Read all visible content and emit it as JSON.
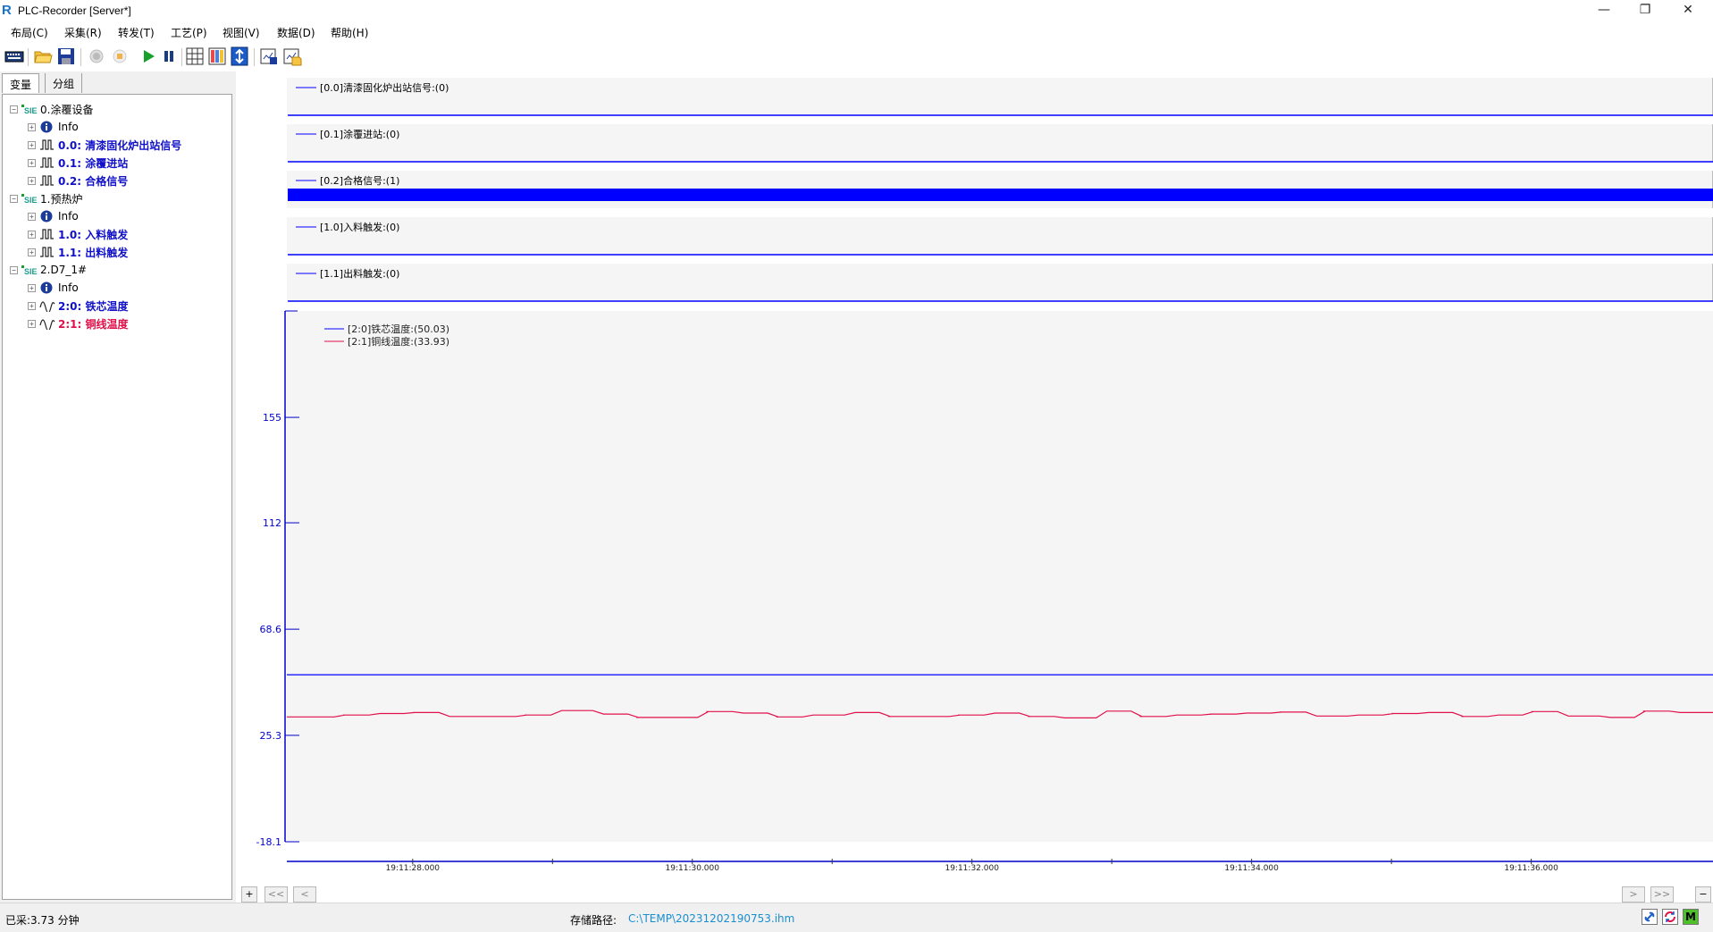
{
  "window": {
    "title": "PLC-Recorder  [Server*]",
    "controls": {
      "minimize": "—",
      "restore": "❐",
      "close": "✕"
    }
  },
  "menu": [
    "布局(C)",
    "采集(R)",
    "转发(T)",
    "工艺(P)",
    "视图(V)",
    "数据(D)",
    "帮助(H)"
  ],
  "toolbar": {
    "icons": [
      "keyboard-icon",
      "open-folder-icon",
      "save-icon",
      "record-disabled-icon",
      "stop-disabled-icon",
      "play-icon",
      "pause-icon",
      "grid-icon",
      "color-palette-icon",
      "fit-vertical-icon",
      "export-icon",
      "import-icon"
    ]
  },
  "left_panel": {
    "tabs": [
      "变量",
      "分组"
    ],
    "tree": [
      {
        "level": 0,
        "icon": "siemens-device-icon",
        "label": "0.涂覆设备",
        "style": "normal"
      },
      {
        "level": 1,
        "icon": "info-icon",
        "label": "Info",
        "style": "normal"
      },
      {
        "level": 1,
        "icon": "digital-signal-icon",
        "label": "0.0: 清漆固化炉出站信号",
        "style": "sig"
      },
      {
        "level": 1,
        "icon": "digital-signal-icon",
        "label": "0.1: 涂覆进站",
        "style": "sig"
      },
      {
        "level": 1,
        "icon": "digital-signal-icon",
        "label": "0.2: 合格信号",
        "style": "sig"
      },
      {
        "level": 0,
        "icon": "siemens-device-icon",
        "label": "1.预热炉",
        "style": "normal"
      },
      {
        "level": 1,
        "icon": "info-icon",
        "label": "Info",
        "style": "normal"
      },
      {
        "level": 1,
        "icon": "digital-signal-icon",
        "label": "1.0: 入料触发",
        "style": "sig"
      },
      {
        "level": 1,
        "icon": "digital-signal-icon",
        "label": "1.1: 出料触发",
        "style": "sig"
      },
      {
        "level": 0,
        "icon": "siemens-device-icon",
        "label": "2.D7_1#",
        "style": "normal"
      },
      {
        "level": 1,
        "icon": "info-icon",
        "label": "Info",
        "style": "normal"
      },
      {
        "level": 1,
        "icon": "analog-signal-icon",
        "label": "2:0: 铁芯温度",
        "style": "sig"
      },
      {
        "level": 1,
        "icon": "analog-signal-icon",
        "label": "2:1: 铜线温度",
        "style": "red"
      }
    ]
  },
  "digital_tracks": [
    {
      "label": "[0.0]清漆固化炉出站信号:(0)",
      "state": 0
    },
    {
      "label": "[0.1]涂覆进站:(0)",
      "state": 0
    },
    {
      "label": "[0.2]合格信号:(1)",
      "state": 1
    },
    {
      "label": "[1.0]入料触发:(0)",
      "state": 0
    },
    {
      "label": "[1.1]出料触发:(0)",
      "state": 0
    }
  ],
  "colors": {
    "signal": "#0000ff",
    "series_red": "#e0104a",
    "axis": "#0000cc",
    "plot_bg": "#f5f5f5"
  },
  "chart_data": {
    "type": "line",
    "ylim": [
      -18.1,
      198.4
    ],
    "yticks": [
      155,
      112,
      68.6,
      25.3,
      -18.1
    ],
    "ytick_labels": [
      "155",
      "112",
      "68.6",
      "25.3",
      "-18.1"
    ],
    "xticks": [
      "19:11:28.000",
      "19:11:30.000",
      "19:11:32.000",
      "19:11:34.000",
      "19:11:36.000"
    ],
    "x_range_s": [
      27.1,
      37.3
    ],
    "xtick_values_s": [
      28,
      30,
      32,
      34,
      36
    ],
    "series": [
      {
        "name": "[2:0]铁芯温度:(50.03)",
        "color": "#0000ff",
        "t": [
          27.1,
          37.3
        ],
        "values": [
          50.03,
          50.03
        ]
      },
      {
        "name": "[2:1]铜线温度:(33.93)",
        "color": "#e0104a",
        "t": [
          27.1,
          27.3,
          27.5,
          27.8,
          28.0,
          28.3,
          28.6,
          28.8,
          29.1,
          29.4,
          29.6,
          29.9,
          30.1,
          30.4,
          30.6,
          30.9,
          31.2,
          31.4,
          31.7,
          31.9,
          32.2,
          32.4,
          32.7,
          33.0,
          33.2,
          33.5,
          33.7,
          34.0,
          34.2,
          34.5,
          34.8,
          35.0,
          35.3,
          35.5,
          35.8,
          36.0,
          36.3,
          36.6,
          36.8,
          37.1,
          37.3
        ],
        "values": [
          32.8,
          32.8,
          33.6,
          34.2,
          34.6,
          33.0,
          33.0,
          33.6,
          35.4,
          34.0,
          32.6,
          32.6,
          35.0,
          34.4,
          32.8,
          33.6,
          34.6,
          33.0,
          33.0,
          33.6,
          34.4,
          33.0,
          32.4,
          35.2,
          33.0,
          33.6,
          34.0,
          34.4,
          34.8,
          33.2,
          33.6,
          34.2,
          34.6,
          33.0,
          33.6,
          35.0,
          33.2,
          32.6,
          35.2,
          34.6,
          34.6
        ]
      }
    ]
  },
  "nav": {
    "add": "+",
    "first": "<<",
    "prev": "<",
    "next": ">",
    "last": ">>",
    "zoom_out": "−"
  },
  "status": {
    "elapsed": "已采:3.73 分钟",
    "path_label": "存储路径:",
    "path": "C:\\TEMP\\20231202190753.ihm",
    "m_badge": "M"
  }
}
